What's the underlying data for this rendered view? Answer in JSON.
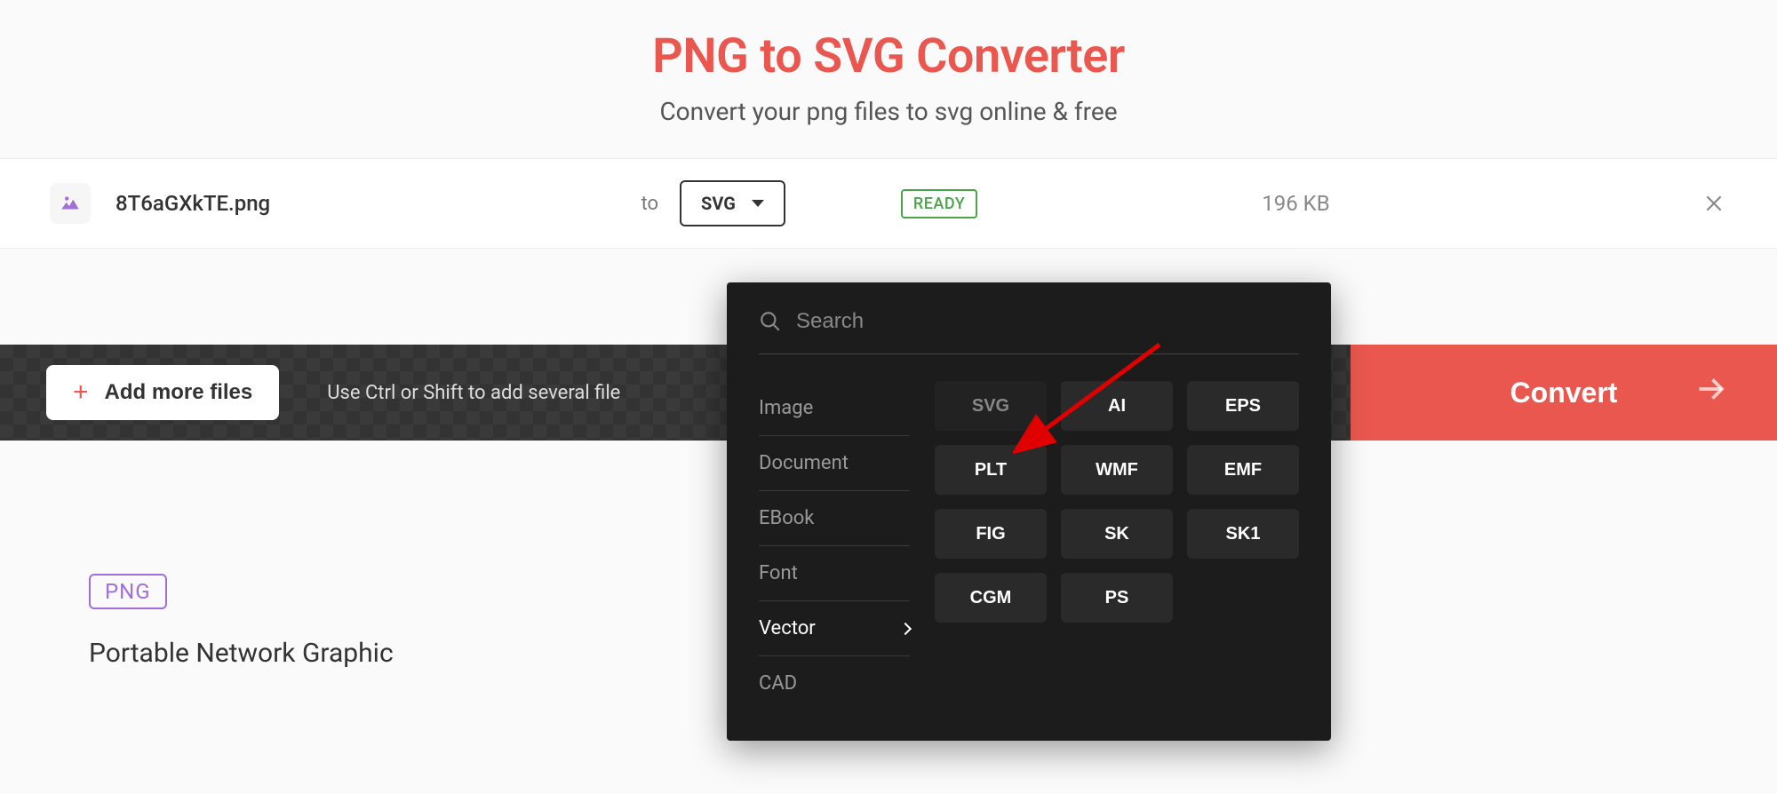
{
  "header": {
    "title": "PNG to SVG Converter",
    "subtitle": "Convert your png files to svg online & free"
  },
  "file_row": {
    "name": "8T6aGXkTE.png",
    "to_label": "to",
    "selected_format": "SVG",
    "status": "READY",
    "size": "196 KB"
  },
  "action_bar": {
    "add_more_label": "Add more files",
    "hint": "Use Ctrl or Shift to add several file",
    "convert_label": "Convert"
  },
  "file_info": {
    "badge": "PNG",
    "desc": "Portable Network Graphic"
  },
  "dropdown": {
    "search_placeholder": "Search",
    "categories": [
      {
        "label": "Image",
        "active": false
      },
      {
        "label": "Document",
        "active": false
      },
      {
        "label": "EBook",
        "active": false
      },
      {
        "label": "Font",
        "active": false
      },
      {
        "label": "Vector",
        "active": true
      },
      {
        "label": "CAD",
        "active": false
      }
    ],
    "formats": [
      "SVG",
      "AI",
      "EPS",
      "PLT",
      "WMF",
      "EMF",
      "FIG",
      "SK",
      "SK1",
      "CGM",
      "PS"
    ]
  }
}
